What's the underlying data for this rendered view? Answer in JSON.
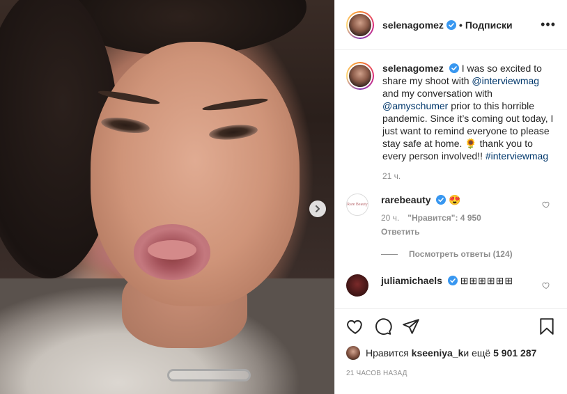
{
  "post": {
    "author": "selenagomez",
    "follow_separator": "•",
    "follow_label": "Подписки",
    "more_label": "•••",
    "caption": {
      "username": "selenagomez",
      "part1": " I was so excited to share my shoot with ",
      "mention1": "@interviewmag",
      "part2": " and my conversation with ",
      "mention2": "@amyschumer",
      "part3": " prior to this horrible pandemic. Since it’s coming out today, I just want to remind everyone to please stay safe at home. ",
      "emoji": "🌻",
      "part4": " thank you to every person involved!! ",
      "hashtag": "#interviewmag",
      "time": "21 ч."
    },
    "comments": [
      {
        "username": "rarebeauty",
        "avatar_text": "Rare Beauty",
        "text": "😍",
        "time": "20 ч.",
        "likes": "\"Нравится\": 4 950",
        "reply_label": "Ответить",
        "view_replies": "Посмотреть ответы (124)"
      },
      {
        "username": "juliamichaels",
        "text": "⊞⊞⊞⊞⊞⊞"
      }
    ],
    "likes_prefix": "Нравится ",
    "likes_user": "kseeniya_k",
    "likes_middle": " и ещё ",
    "likes_count": "5 901 287",
    "posted_ago": "21 часов назад"
  },
  "colors": {
    "verified": "#3897f0",
    "link": "#00376b",
    "muted": "#8e8e8e",
    "text": "#262626"
  },
  "icons": [
    "verified-icon",
    "more-icon",
    "heart-icon",
    "comment-icon",
    "share-icon",
    "bookmark-icon",
    "next-arrow-icon"
  ]
}
